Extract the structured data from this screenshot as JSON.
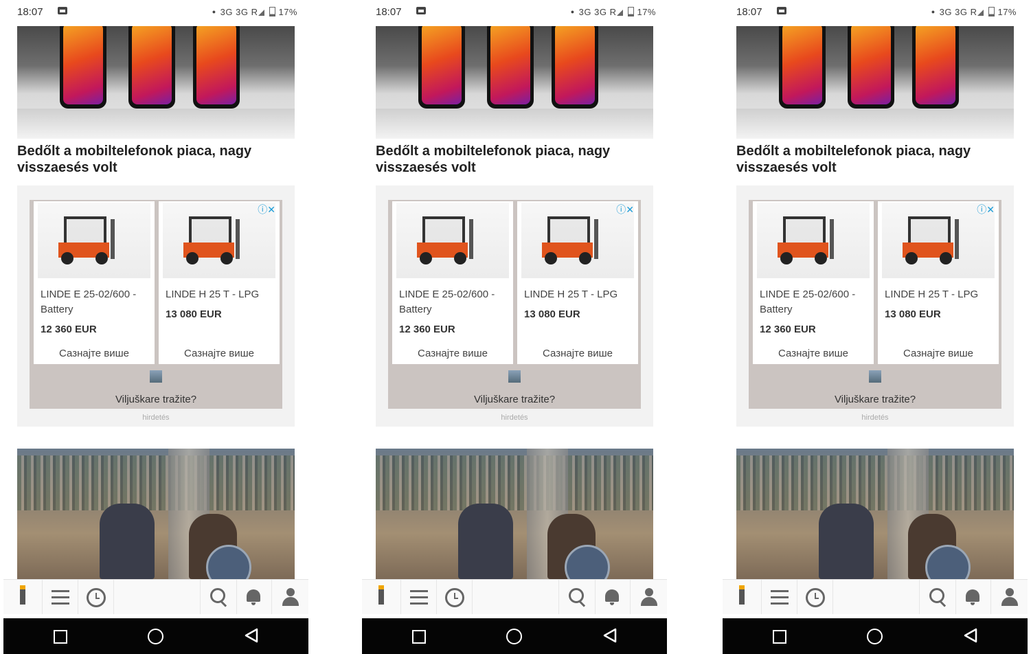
{
  "status_bar": {
    "time": "18:07",
    "network": "3G 3G R",
    "battery": "17%"
  },
  "article1": {
    "headline": "Bedőlt a mobiltelefonok piaca, nagy visszaesés volt"
  },
  "ad": {
    "cards": [
      {
        "title": "LINDE E 25-02/600 - Battery",
        "price": "12 360 EUR",
        "cta": "Сазнајте више"
      },
      {
        "title": "LINDE H 25 T - LPG",
        "price": "13 080 EUR",
        "cta": "Сазнајте више"
      }
    ],
    "info_icon": "ⓘ✕",
    "footer_text": "Viljuškare tražite?",
    "label": "hirdetés"
  },
  "bottom_nav": {
    "items": [
      "logo",
      "menu-icon",
      "clock-icon",
      "search-icon",
      "bell-icon",
      "user-icon"
    ]
  },
  "system_nav": {
    "items": [
      "recents-square",
      "home-circle",
      "back-triangle"
    ]
  }
}
